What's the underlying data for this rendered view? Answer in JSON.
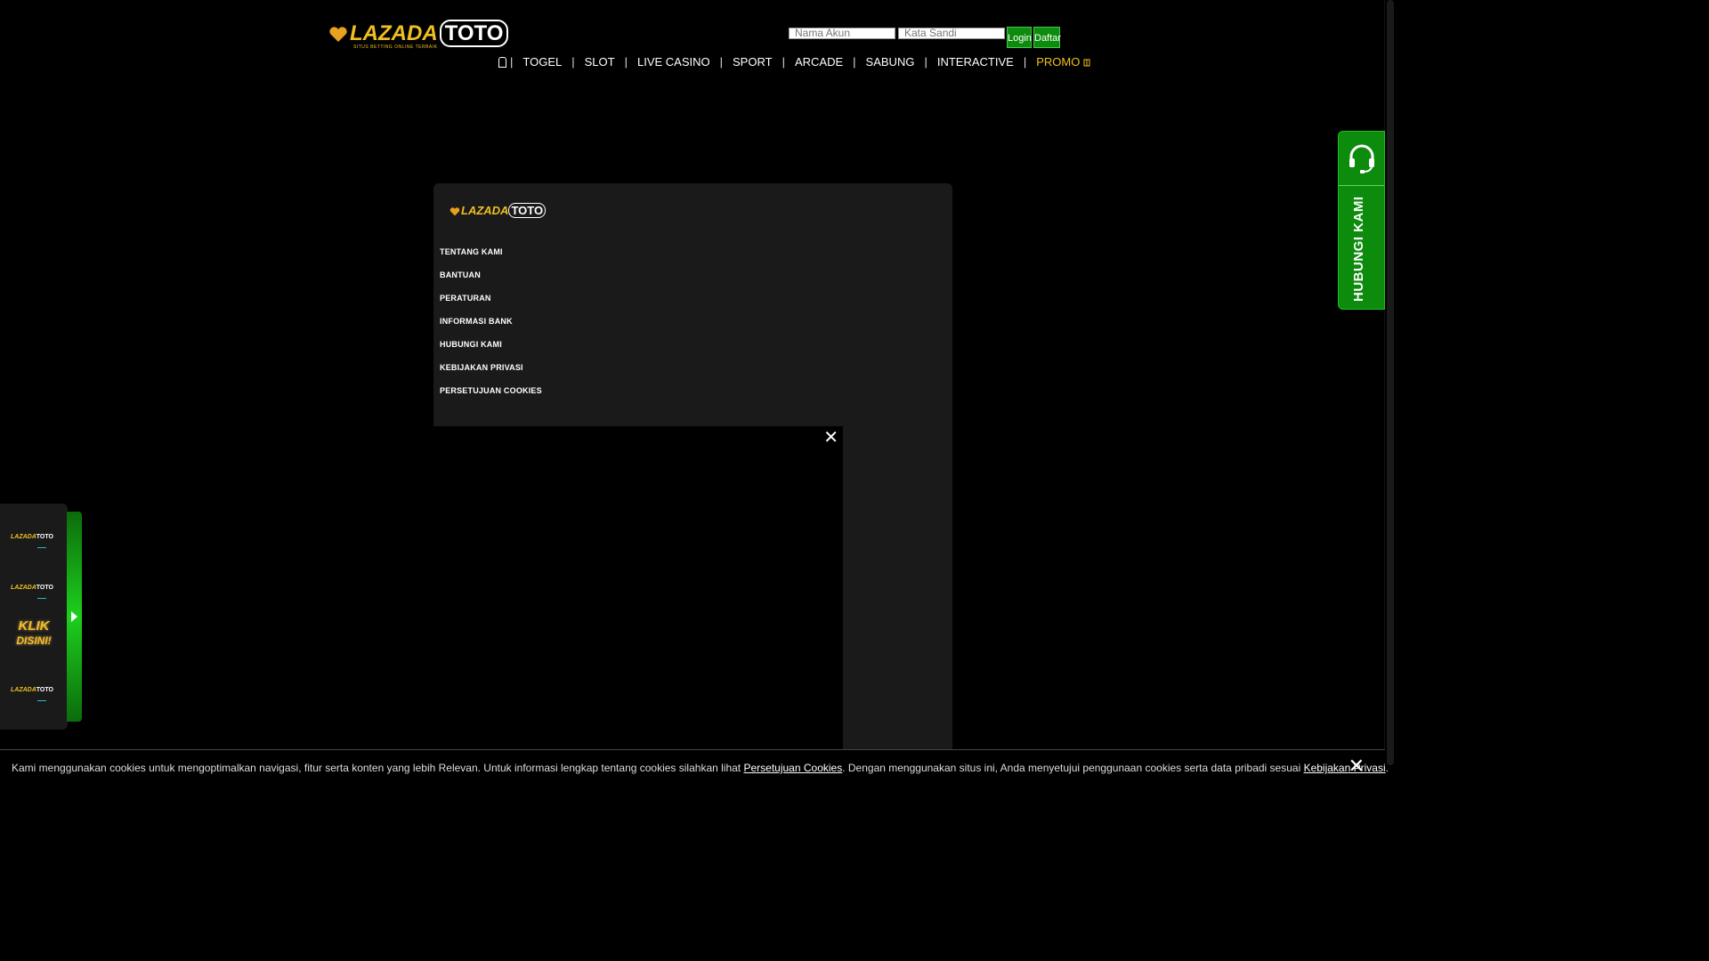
{
  "header": {
    "logo_text": "LAZADA",
    "logo_toto": "TOTO",
    "logo_tagline": "SITUS BETTING ONLINE TERBAIK",
    "username_placeholder": "Nama Akun",
    "password_placeholder": "Kata Sandi",
    "login_label": "Login",
    "register_label": "Daftar"
  },
  "nav": {
    "items": [
      "TOGEL",
      "SLOT",
      "LIVE CASINO",
      "SPORT",
      "ARCADE",
      "SABUNG",
      "INTERACTIVE"
    ],
    "promo": "PROMO",
    "separator": "|"
  },
  "footer_panel": {
    "logo_text": "LAZADA",
    "logo_toto": "TOTO",
    "links": [
      "TENTANG KAMI",
      "BANTUAN",
      "PERATURAN",
      "INFORMASI BANK",
      "HUBUNGI KAMI",
      "KEBIJAKAN PRIVASI",
      "PERSETUJUAN COOKIES"
    ]
  },
  "video": {
    "close_glyph": "✕"
  },
  "contact_widget": {
    "label": "HUBUNGI KAMI",
    "icon": "headset-icon"
  },
  "side_panel": {
    "items": [
      "LAZADA",
      "LAZADA",
      "LAZADA"
    ],
    "item_toto": "TOTO",
    "klik_line1": "KLIK",
    "klik_line2": "DISINI!"
  },
  "cookie_bar": {
    "text_before": "Kami menggunakan cookies untuk mengoptimalkan navigasi, fitur serta konten yang lebih Relevan. Untuk informasi lengkap tentang cookies silahkan lihat ",
    "link1": "Persetujuan Cookies",
    "text_middle": ". Dengan menggunakan situs ini, Anda menyetujui penggunaan cookies serta data pribadi sesuai ",
    "link2": "Kebijakan Privasi",
    "text_after": ".",
    "close_glyph": "✕"
  },
  "colors": {
    "accent_green": "#0c8b0c",
    "gold": "#f0c020",
    "background": "#000000"
  }
}
